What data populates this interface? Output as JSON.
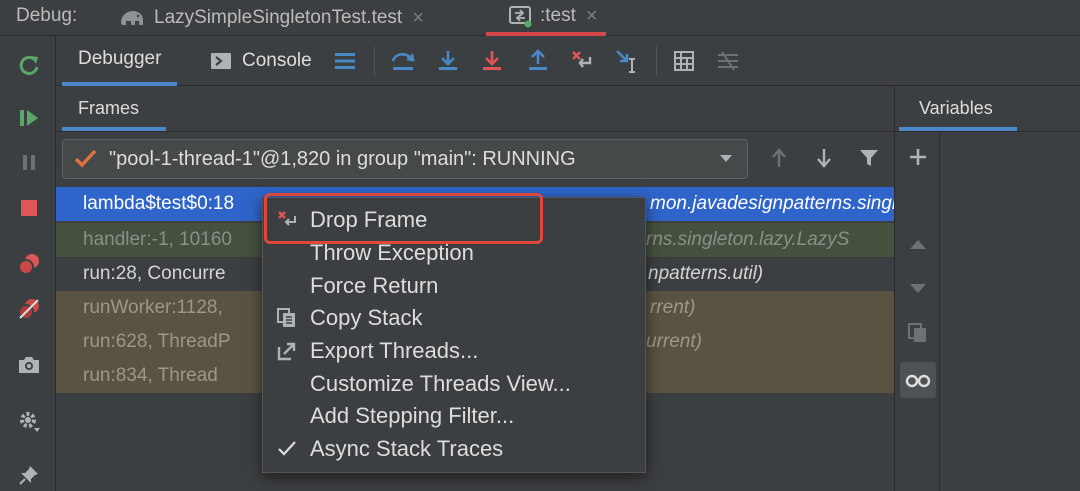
{
  "topbar": {
    "debug_label": "Debug:",
    "tabs": [
      {
        "label": "LazySimpleSingletonTest.test",
        "close": "×"
      },
      {
        "label": ":test",
        "close": "×"
      }
    ]
  },
  "toolbar": {
    "tabs": [
      {
        "label": "Debugger"
      },
      {
        "label": "Console"
      }
    ]
  },
  "frames": {
    "header": "Frames",
    "thread": "\"pool-1-thread-1\"@1,820 in group \"main\": RUNNING",
    "rows": [
      {
        "left": "lambda$test$0:18",
        "right": "mon.javadesignpatterns.singleton.lazy)"
      },
      {
        "left": "handler:-1, 10160",
        "right": "rns.singleton.lazy.LazyS"
      },
      {
        "left": "run:28, Concurre",
        "right": "npatterns.util)"
      },
      {
        "left": "runWorker:1128,",
        "right": "rrent)"
      },
      {
        "left": "run:628, ThreadP",
        "right": "urrent)"
      },
      {
        "left": "run:834, Thread",
        "right": ""
      }
    ]
  },
  "variables": {
    "header": "Variables"
  },
  "context_menu": {
    "items": [
      {
        "label": "Drop Frame",
        "icon": "drop-frame-icon"
      },
      {
        "label": "Throw Exception",
        "icon": ""
      },
      {
        "label": "Force Return",
        "icon": ""
      },
      {
        "label": "Copy Stack",
        "icon": "copy-icon"
      },
      {
        "label": "Export Threads...",
        "icon": "export-icon"
      },
      {
        "label": "Customize Threads View...",
        "icon": ""
      },
      {
        "label": "Add Stepping Filter...",
        "icon": ""
      },
      {
        "label": "Async Stack Traces",
        "icon": "checkmark-icon"
      }
    ]
  },
  "colors": {
    "selected_row": "#2f65ca",
    "highlight_box": "#e0473a",
    "accent_tab": "#4a88c7",
    "active_run_tab": "#d3464a"
  }
}
